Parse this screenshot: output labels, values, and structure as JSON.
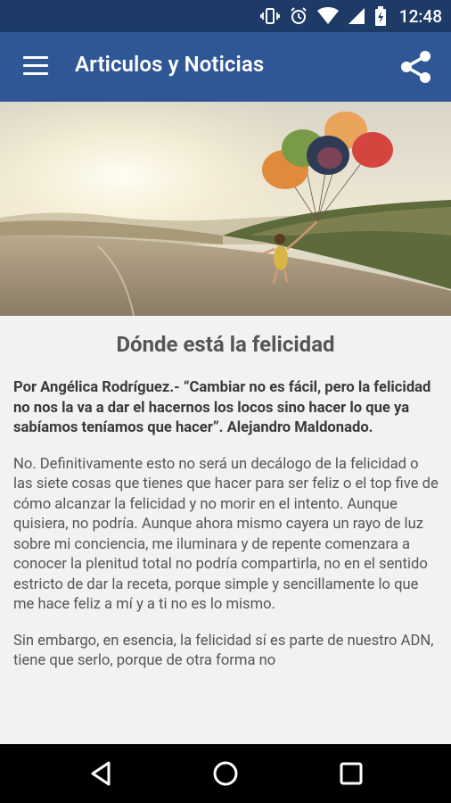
{
  "status_bar": {
    "time": "12:48",
    "icons": [
      "vibrate-icon",
      "alarm-icon",
      "wifi-icon",
      "signal-icon",
      "battery-charging-icon"
    ]
  },
  "app_bar": {
    "title": "Articulos y Noticias",
    "menu_icon": "menu-icon",
    "share_icon": "share-icon",
    "color": "#2f5796"
  },
  "hero_image": {
    "description_icon": "balloon-girl-image"
  },
  "article": {
    "title": "Dónde está la felicidad",
    "lead": "Por Angélica Rodríguez.- “Cambiar no es fácil, pero la felicidad no nos la va a dar el hacernos los locos sino hacer lo que ya sabíamos teníamos que hacer”. Alejandro Maldonado.",
    "paragraph1": "No. Definitivamente esto no será un decálogo de la felicidad o las siete cosas que tienes que hacer para ser feliz o el top five de cómo alcanzar la felicidad y no morir en el intento. Aunque quisiera, no podría. Aunque ahora mismo cayera un rayo de luz sobre mi conciencia, me iluminara y de repente comenzara a conocer la plenitud total no podría compartirla, no en el sentido estricto de dar la receta, porque simple y sencillamente lo que me hace feliz a mí y a ti no es lo mismo.",
    "paragraph2": "Sin embargo, en esencia, la felicidad sí es parte de nuestro ADN, tiene que serlo, porque de otra forma no"
  },
  "nav_bar": {
    "buttons": [
      "back-icon",
      "home-icon",
      "recents-icon"
    ]
  }
}
